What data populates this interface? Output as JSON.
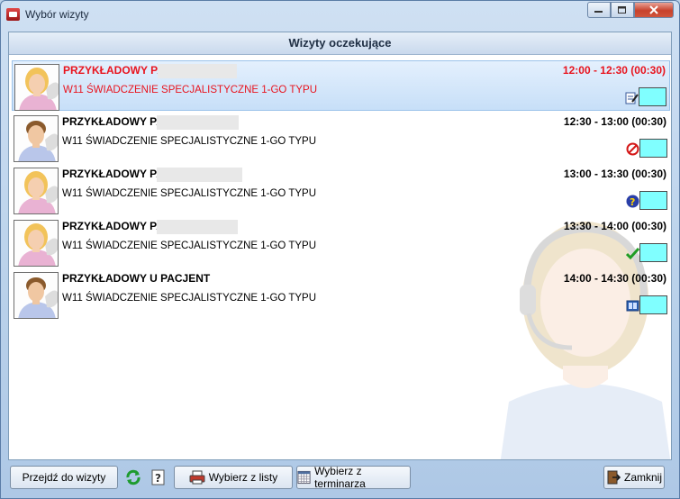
{
  "window": {
    "title": "Wybór wizyty"
  },
  "header": {
    "title": "Wizyty oczekujące"
  },
  "visits": [
    {
      "patient": "PRZYKŁADOWY PACJENT.",
      "service": "W11 ŚWIADCZENIE SPECJALISTYCZNE 1-GO TYPU",
      "time": "12:00 - 12:30 (00:30)",
      "status_icon": "edit-icon",
      "avatar": "female-patient-icon"
    },
    {
      "patient": "PRZYKŁADOWY PACJENT.",
      "service": "W11 ŚWIADCZENIE SPECJALISTYCZNE 1-GO TYPU",
      "time": "12:30 - 13:00 (00:30)",
      "status_icon": "cancelled-icon",
      "avatar": "male-patient-icon"
    },
    {
      "patient": "PRZYKŁADOWY PACJENT.",
      "service": "W11 ŚWIADCZENIE SPECJALISTYCZNE 1-GO TYPU",
      "time": "13:00 - 13:30 (00:30)",
      "status_icon": "question-icon",
      "avatar": "female-patient-icon"
    },
    {
      "patient": "PRZYKŁADOWY PACJENT.",
      "service": "W11 ŚWIADCZENIE SPECJALISTYCZNE 1-GO TYPU",
      "time": "13:30 - 14:00 (00:30)",
      "status_icon": "checkmark-icon",
      "avatar": "female-patient-icon"
    },
    {
      "patient": "PRZYKŁADOWY U PACJENT",
      "service": "W11 ŚWIADCZENIE SPECJALISTYCZNE 1-GO TYPU",
      "time": "14:00 - 14:30 (00:30)",
      "status_icon": "book-icon",
      "avatar": "male-patient-icon"
    }
  ],
  "toolbar": {
    "goto_visit": "Przejdź do wizyty",
    "select_from_list": "Wybierz z listy",
    "select_from_schedule": "Wybierz z terminarza",
    "close": "Zamknij"
  },
  "colors": {
    "selected_text": "#e8141e",
    "status_box": "#80ffff"
  }
}
